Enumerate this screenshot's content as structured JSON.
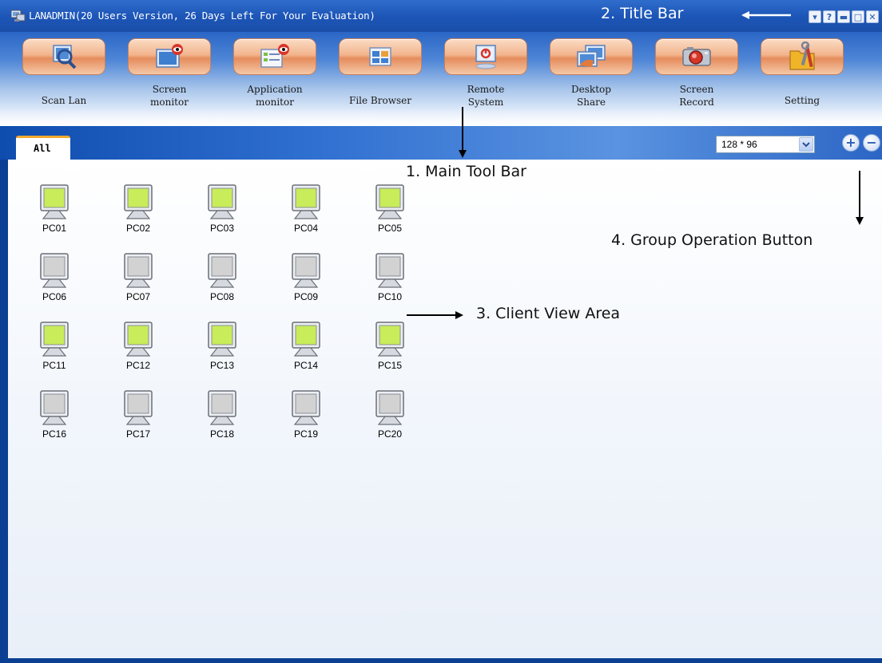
{
  "window": {
    "title": "LANADMIN(20 Users Version, 26 Days Left For Your Evaluation)",
    "controls": [
      {
        "name": "menu-button",
        "glyph": "▾"
      },
      {
        "name": "help-button",
        "glyph": "?"
      },
      {
        "name": "minimize-button",
        "glyph": "▬"
      },
      {
        "name": "maximize-button",
        "glyph": "□"
      },
      {
        "name": "close-button",
        "glyph": "✕"
      }
    ]
  },
  "toolbar": {
    "items": [
      {
        "label": "Scan Lan",
        "icon": "scan-lan-icon"
      },
      {
        "label": "Screen\nmonitor",
        "icon": "screen-monitor-icon"
      },
      {
        "label": "Application\nmonitor",
        "icon": "application-monitor-icon"
      },
      {
        "label": "File Browser",
        "icon": "file-browser-icon"
      },
      {
        "label": "Remote\nSystem",
        "icon": "remote-system-icon"
      },
      {
        "label": "Desktop\nShare",
        "icon": "desktop-share-icon"
      },
      {
        "label": "Screen\nRecord",
        "icon": "screen-record-icon"
      },
      {
        "label": "Setting",
        "icon": "setting-icon"
      }
    ]
  },
  "tabs": {
    "all_label": "All"
  },
  "view_size": {
    "selected": "128 * 96"
  },
  "group_ops": {
    "add_glyph": "+",
    "remove_glyph": "−"
  },
  "clients": [
    {
      "label": "PC01",
      "status": "online"
    },
    {
      "label": "PC02",
      "status": "online"
    },
    {
      "label": "PC03",
      "status": "online"
    },
    {
      "label": "PC04",
      "status": "online"
    },
    {
      "label": "PC05",
      "status": "online"
    },
    {
      "label": "PC06",
      "status": "offline"
    },
    {
      "label": "PC07",
      "status": "offline"
    },
    {
      "label": "PC08",
      "status": "offline"
    },
    {
      "label": "PC09",
      "status": "offline"
    },
    {
      "label": "PC10",
      "status": "offline"
    },
    {
      "label": "PC11",
      "status": "online"
    },
    {
      "label": "PC12",
      "status": "online"
    },
    {
      "label": "PC13",
      "status": "online"
    },
    {
      "label": "PC14",
      "status": "online"
    },
    {
      "label": "PC15",
      "status": "online"
    },
    {
      "label": "PC16",
      "status": "offline"
    },
    {
      "label": "PC17",
      "status": "offline"
    },
    {
      "label": "PC18",
      "status": "offline"
    },
    {
      "label": "PC19",
      "status": "offline"
    },
    {
      "label": "PC20",
      "status": "offline"
    }
  ],
  "annotations": {
    "title_bar": "2. Title Bar",
    "main_tool_bar": "1. Main Tool Bar",
    "group_operation_button": "4. Group Operation Button",
    "client_view_area": "3. Client View Area"
  },
  "colors": {
    "online_screen": "#c8ec5a",
    "offline_screen": "#d2d2d2",
    "titlebar": "#1d56b8",
    "tab_accent": "#f0a830"
  }
}
